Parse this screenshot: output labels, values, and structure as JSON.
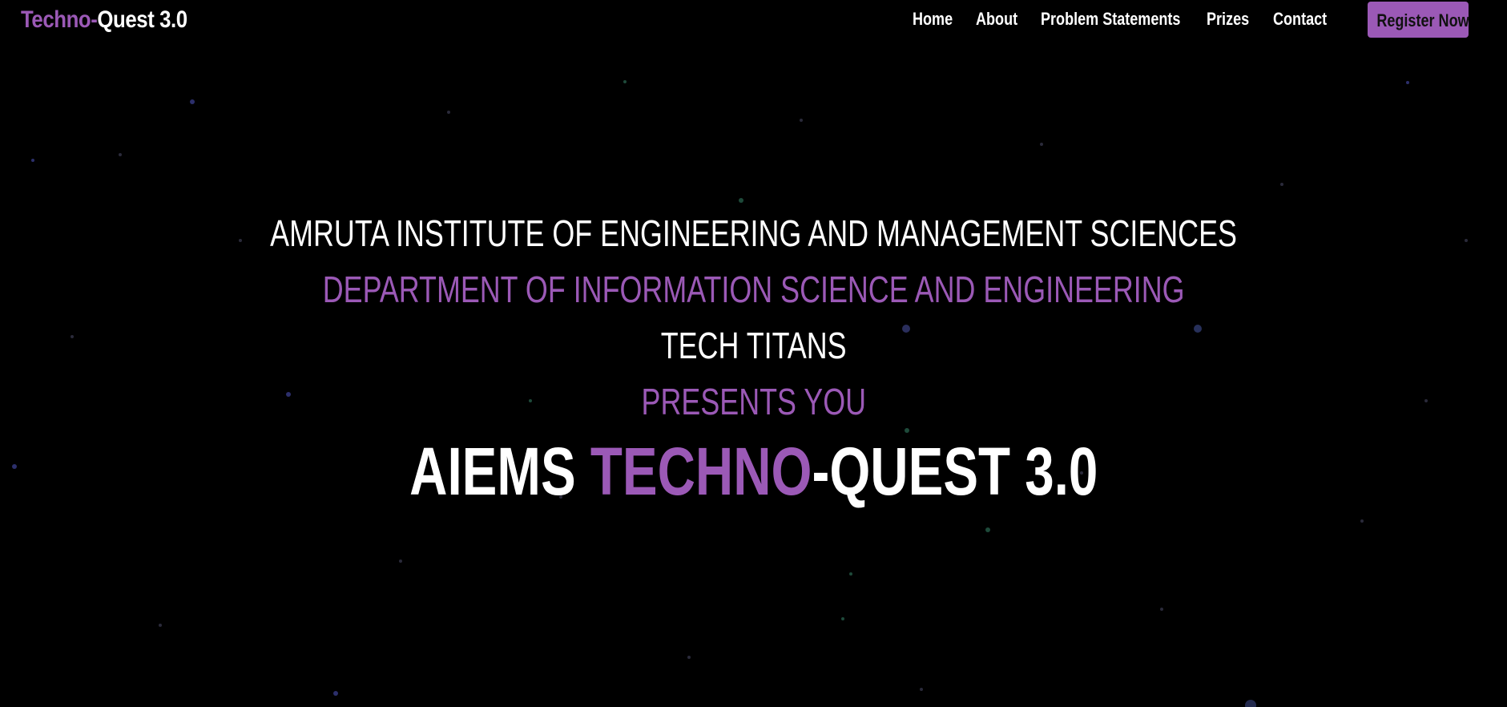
{
  "nav": {
    "logo_part1": "Techno-",
    "logo_part2": "Quest 3.0",
    "links": [
      "Home",
      "About",
      "Problem Statements",
      "Prizes",
      "Contact"
    ],
    "register_label": "Register Now"
  },
  "hero": {
    "institute": "AMRUTA INSTITUTE OF ENGINEERING AND MANAGEMENT SCIENCES",
    "department": "DEPARTMENT OF INFORMATION SCIENCE AND ENGINEERING",
    "club": "TECH TITANS",
    "presents": "PRESENTS YOU",
    "title_part1": "AIEMS ",
    "title_part2": "TECHNO",
    "title_part3": "-QUEST 3.0"
  },
  "colors": {
    "accent": "#9b59b6",
    "background": "#000000",
    "text": "#ffffff"
  }
}
